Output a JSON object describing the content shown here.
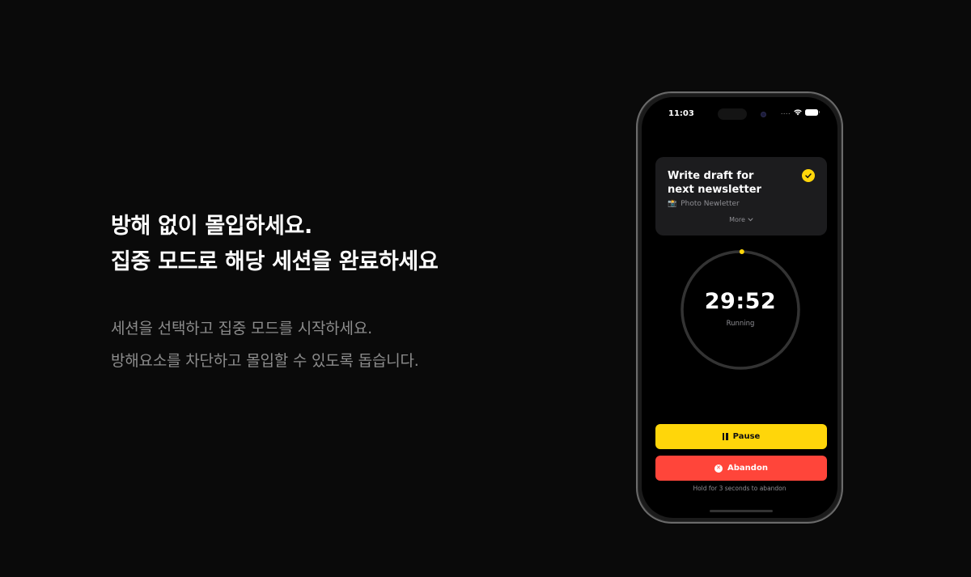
{
  "hero": {
    "headline_line1": "방해 없이 몰입하세요.",
    "headline_line2": "집중 모드로 해당 세션을 완료하세요",
    "desc_line1": "세션을 선택하고 집중 모드를 시작하세요.",
    "desc_line2": "방해요소를 차단하고 몰입할 수 있도록 돕습니다."
  },
  "status_bar": {
    "time": "11:03",
    "signal": "....",
    "wifi_icon": "wifi-icon",
    "battery_icon": "battery-icon"
  },
  "task_card": {
    "title_line1": "Write draft for",
    "title_line2": "next newsletter",
    "project_icon": "📸",
    "project": "Photo Newletter",
    "more_label": "More",
    "check_icon": "check-circle-icon"
  },
  "timer": {
    "time": "29:52",
    "status": "Running",
    "progress_fraction": 0.004,
    "ring_color": "#333333",
    "indicator_color": "#ffd60a"
  },
  "actions": {
    "pause_label": "Pause",
    "abandon_label": "Abandon",
    "hold_hint": "Hold for 3 seconds to abandon"
  },
  "colors": {
    "accent": "#ffd60a",
    "danger": "#ff453a",
    "card_bg": "#1c1c1e",
    "secondary_text": "#8e8e93"
  }
}
